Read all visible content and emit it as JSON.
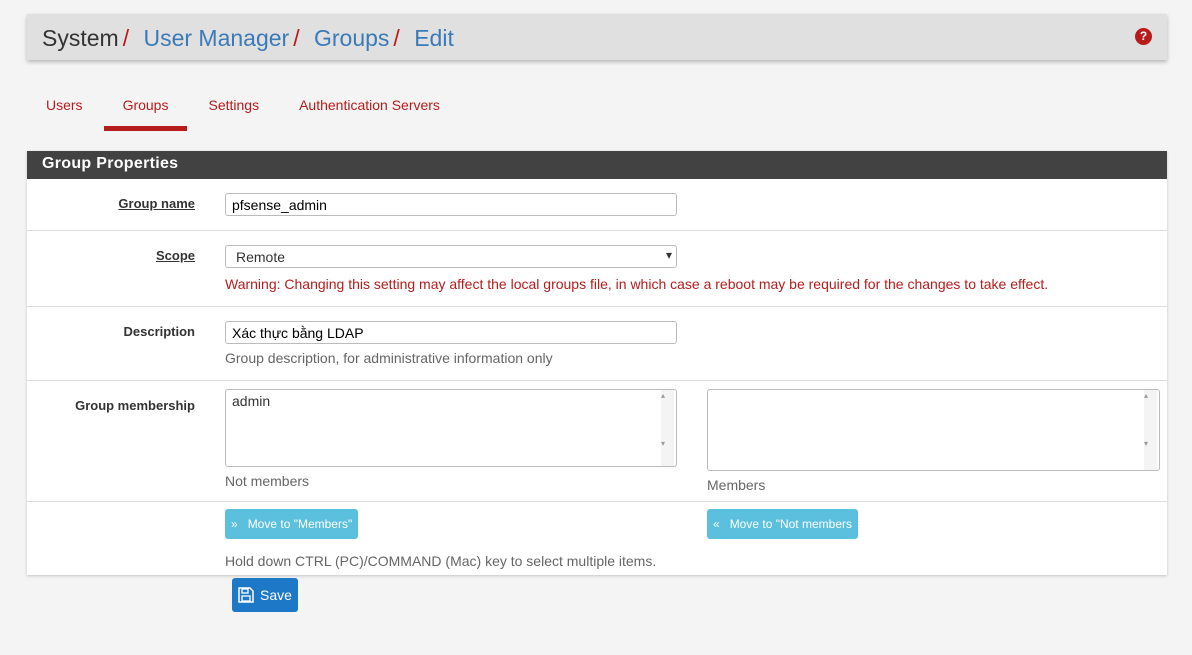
{
  "breadcrumb": {
    "root": "System",
    "items": [
      "User Manager",
      "Groups",
      "Edit"
    ],
    "separator": "/"
  },
  "help_icon": "question-circle-icon",
  "tabs": [
    {
      "label": "Users"
    },
    {
      "label": "Groups",
      "active": true
    },
    {
      "label": "Settings"
    },
    {
      "label": "Authentication Servers"
    }
  ],
  "panel": {
    "title": "Group Properties"
  },
  "form": {
    "group_name": {
      "label": "Group name",
      "value": "pfsense_admin"
    },
    "scope": {
      "label": "Scope",
      "value": "Remote",
      "warning": "Warning: Changing this setting may affect the local groups file, in which case a reboot may be required for the changes to take effect."
    },
    "description": {
      "label": "Description",
      "value": "Xác thực bằng LDAP",
      "help": "Group description, for administrative information only"
    },
    "membership": {
      "label": "Group membership",
      "not_members": [
        "admin"
      ],
      "not_members_label": "Not members",
      "members": [],
      "members_label": "Members"
    },
    "move_to_members": "Move to \"Members\"",
    "move_to_not_members": "Move to \"Not members",
    "multi_select_help": "Hold down CTRL (PC)/COMMAND (Mac) key to select multiple items."
  },
  "save_label": "Save"
}
